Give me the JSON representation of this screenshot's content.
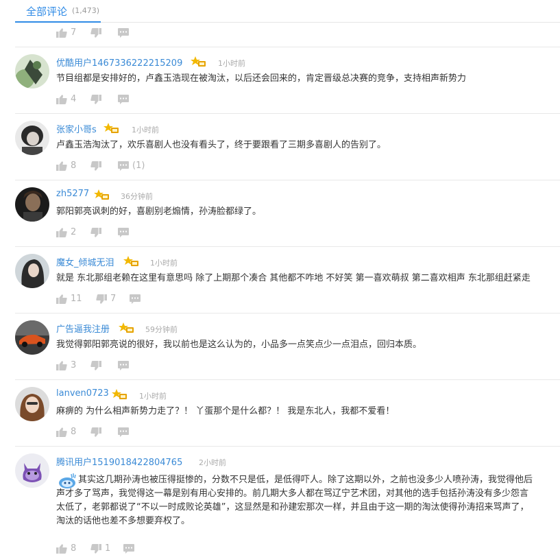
{
  "tab": {
    "label": "全部评论",
    "count": "(1,473)"
  },
  "top_bar": {
    "likes": "7",
    "dislikes": "",
    "replies": ""
  },
  "comments": [
    {
      "user": "优酷用户1467336222215209",
      "time": "1小时前",
      "text": "节目组都是安排好的，卢鑫玉浩现在被淘汰，以后还会回来的，肯定晋级总决赛的竞争，支持相声新势力",
      "likes": "4",
      "dislikes": "",
      "replies": ""
    },
    {
      "user": "张家小哥s",
      "time": "1小时前",
      "text": "卢鑫玉浩淘汰了，欢乐喜剧人也没有看头了，终于要跟看了三期多喜剧人的告别了。",
      "likes": "8",
      "dislikes": "",
      "replies": "(1)"
    },
    {
      "user": "zh5277",
      "time": "36分钟前",
      "text": "郭阳郭亮讽刺的好，喜剧别老煽情，孙涛脸都绿了。",
      "likes": "2",
      "dislikes": "",
      "replies": ""
    },
    {
      "user": "魔女_倾城无泪",
      "time": "1小时前",
      "text": "就是 东北那组老赖在这里有意思吗 除了上期那个凑合 其他都不咋地 不好笑 第一喜欢萌叔 第二喜欢相声 东北那组赶紧走",
      "likes": "11",
      "dislikes": "7",
      "replies": ""
    },
    {
      "user": "广告逼我注册",
      "time": "59分钟前",
      "text": "我觉得郭阳郭亮说的很好，我以前也是这么认为的，小品多一点笑点少一点泪点，回归本质。",
      "likes": "3",
      "dislikes": "",
      "replies": ""
    },
    {
      "user": "lanven0723",
      "time": "1小时前",
      "text": "麻痹的 为什么相声新势力走了？！ 丫蛋那个是什么都？！ 我是东北人，我都不爱看！",
      "likes": "8",
      "dislikes": "",
      "replies": ""
    },
    {
      "user": "腾讯用户1519018422804765",
      "time": "2小时前",
      "lines": [
        "其实这几期孙涛也被压得挺惨的，分数不只是低，是低得吓人。除了这期以外，之前也没多少人喷孙涛，我觉得他后",
        "声才多了骂声，我觉得这一幕是别有用心安排的。前几期大多人都在骂辽宁艺术团，对其他的选手包括孙涛没有多少怨言",
        "太低了，老郭都说了“不以一时成败论英雄”，这显然是和孙建宏那次一样，并且由于这一期的淘汰使得孙涛招来骂声了，",
        "淘汰的话他也差不多想要弃权了。"
      ],
      "likes": "8",
      "dislikes": "1",
      "replies": ""
    }
  ],
  "icons": {
    "like": "thumb-up-icon",
    "dislike": "thumb-down-icon",
    "reply": "comment-icon",
    "badge": "vip-level-badge-icon"
  },
  "colors": {
    "accent": "#2e8ae6",
    "username": "#3a8ad6",
    "icon": "#c8c8c8",
    "badge": "#f2b800"
  }
}
